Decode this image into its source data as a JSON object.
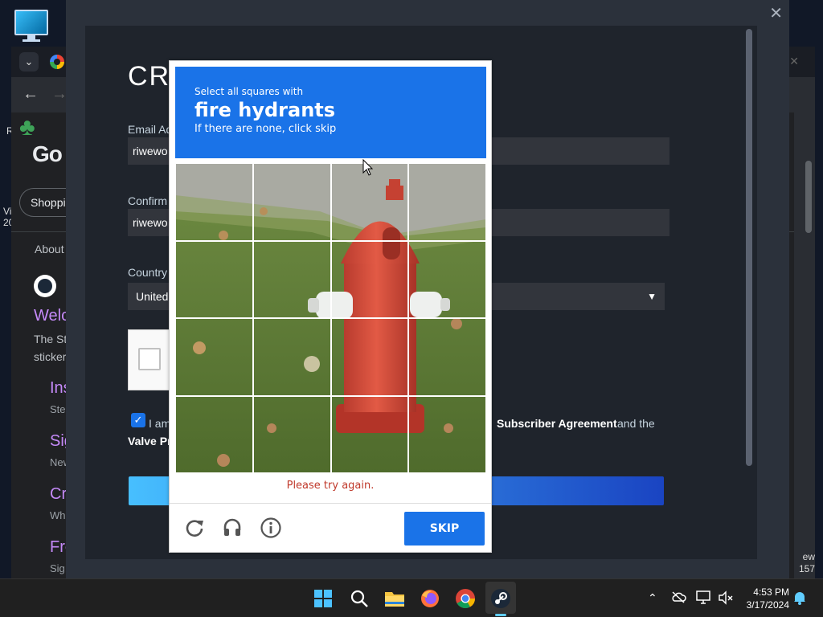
{
  "browser": {
    "brand": "Go",
    "filter_pill": "Shoppi",
    "about": "About",
    "welcome": "Welc",
    "body_line1": "The St",
    "body_line2": "sticker",
    "links": [
      {
        "title": "Ins",
        "sub": "Ste"
      },
      {
        "title": "Sig",
        "sub": "New"
      },
      {
        "title": "Cr",
        "sub": "Whe"
      },
      {
        "title": "Fre",
        "sub": "Sig"
      }
    ],
    "edge_left_r": "R",
    "edge_left_v": "Vi",
    "edge_left_20": "20",
    "edge_right_view": "ew",
    "edge_right_num": "157"
  },
  "steam": {
    "title": "CRE",
    "email_label": "Email Ad",
    "email_value": "riwewo",
    "confirm_label": "Confirm",
    "confirm_value": "riwewo",
    "country_label": "Country",
    "country_value": "United",
    "agree_prefix": "I am",
    "agree_middle": "Subscriber Agreement",
    "agree_and": "and the",
    "agree_line2": "Valve Pr"
  },
  "captcha": {
    "instruction_small": "Select all squares with",
    "target": "fire hydrants",
    "hint": "If there are none, click skip",
    "error": "Please try again.",
    "skip_label": "SKIP",
    "grid_rows": 4,
    "grid_cols": 4,
    "icons": [
      "reload-icon",
      "audio-icon",
      "info-icon"
    ]
  },
  "taskbar": {
    "apps": [
      "windows-start-icon",
      "search-icon",
      "file-explorer-icon",
      "firefox-icon",
      "chrome-icon",
      "steam-icon"
    ],
    "active_app": "steam-icon",
    "time": "4:53 PM",
    "date": "3/17/2024"
  },
  "colors": {
    "captcha_blue": "#1a73e8",
    "error_red": "#c0392b",
    "steam_bg": "#1f242c",
    "link_purple": "#c58af9"
  }
}
